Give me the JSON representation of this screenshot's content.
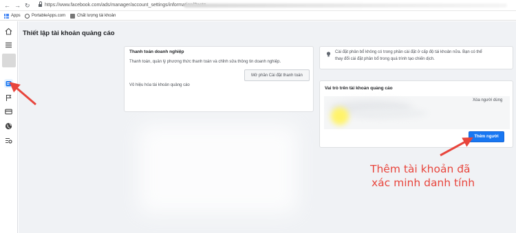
{
  "browser": {
    "url": "https://www.facebook.com/ads/manager/account_settings/information/?act="
  },
  "bookmarks": [
    {
      "label": "Apps",
      "icon": "apps-grid-icon"
    },
    {
      "label": "PortableApps.com",
      "icon": "portableapps-icon"
    },
    {
      "label": "Chất lượng tài khoản",
      "icon": "document-icon"
    }
  ],
  "rail": {
    "items": [
      "home-icon",
      "menu-icon",
      "account-avatar",
      "billing-icon",
      "flag-icon",
      "credit-card-icon",
      "globe-icon",
      "settings-list-icon"
    ]
  },
  "page": {
    "title": "Thiết lập tài khoản quảng cáo"
  },
  "business_payment": {
    "title": "Thanh toán doanh nghiệp",
    "description": "Thanh toán, quản lý phương thức thanh toán và chỉnh sửa thông tin doanh nghiệp.",
    "open_button": "Mở phần Cài đặt thanh toán",
    "deactivate_link": "Vô hiệu hóa tài khoản quảng cáo"
  },
  "notice": {
    "line1": "Cài đặt phân bổ không có trong phần cài đặt ở cấp độ tài khoản nữa. Bạn có thể",
    "line2": "thay đổi cài đặt phân bổ trong quá trình tạo chiến dịch."
  },
  "roles": {
    "title": "Vai trò trên tài khoản quảng cáo",
    "remove_link": "Xóa người dùng",
    "add_button": "Thêm người"
  },
  "annotation": {
    "line1": "Thêm tài khoản đã",
    "line2": "xác minh danh tính"
  },
  "colors": {
    "accent": "#1877f2",
    "annotation": "#e8453c",
    "background": "#f0f2f5"
  }
}
